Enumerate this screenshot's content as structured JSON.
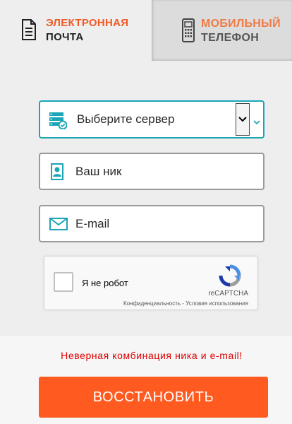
{
  "tabs": {
    "email": {
      "line1": "ЭЛЕКТРОННАЯ",
      "line2": "ПОЧТА",
      "icon": "document-icon",
      "active": true
    },
    "phone": {
      "line1": "МОБИЛЬНЫЙ",
      "line2": "ТЕЛЕФОН",
      "icon": "mobile-phone-icon",
      "active": false
    }
  },
  "form": {
    "server": {
      "label": "Выберите сервер",
      "icon": "server-icon"
    },
    "nick": {
      "placeholder": "Ваш ник",
      "icon": "user-card-icon"
    },
    "email": {
      "placeholder": "E-mail",
      "icon": "envelope-icon"
    }
  },
  "captcha": {
    "label": "Я не робот",
    "brand": "reCAPTCHA",
    "links": "Конфиденциальность - Условия использования"
  },
  "error": "Неверная комбинация ника и e-mail!",
  "submit_label": "ВОССТАНОВИТЬ",
  "colors": {
    "accent": "#ff5a1f",
    "teal": "#1aa6b7",
    "error": "#e00000"
  }
}
